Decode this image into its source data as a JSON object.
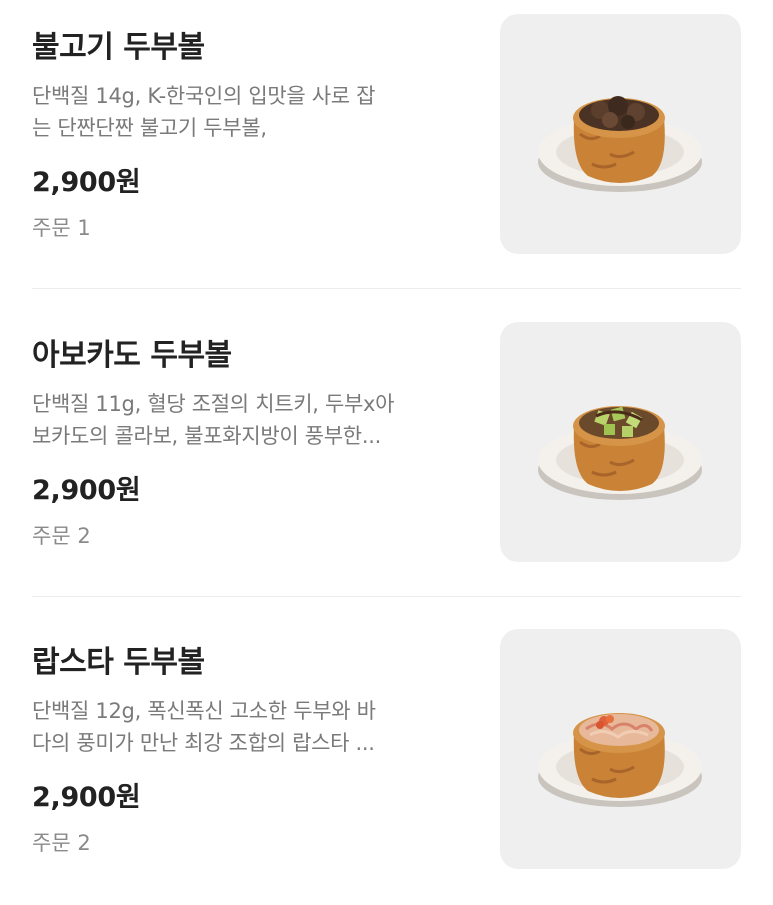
{
  "menu": {
    "items": [
      {
        "name": "불고기 두부볼",
        "desc_line1": "단백질 14g, K-한국인의 입맛을 사로 잡",
        "desc_line2": "는 단짠단짠 불고기 두부볼,",
        "price": "2,900원",
        "orders": "주문 1",
        "image_icon": "bulgogi-tofu-ball-image"
      },
      {
        "name": "아보카도 두부볼",
        "desc_line1": "단백질 11g, 혈당 조절의 치트키, 두부x아",
        "desc_line2": "보카도의 콜라보, 불포화지방이 풍부한...",
        "price": "2,900원",
        "orders": "주문 2",
        "image_icon": "avocado-tofu-ball-image"
      },
      {
        "name": "랍스타 두부볼",
        "desc_line1": "단백질 12g, 폭신폭신 고소한 두부와 바",
        "desc_line2": "다의 풍미가 만난 최강 조합의 랍스타 ...",
        "price": "2,900원",
        "orders": "주문 2",
        "image_icon": "lobster-tofu-ball-image"
      }
    ]
  },
  "colors": {
    "title": "#222222",
    "description": "#7a7a7a",
    "thumb_background": "#efefef",
    "tofu_skin": "#d08a3c"
  }
}
